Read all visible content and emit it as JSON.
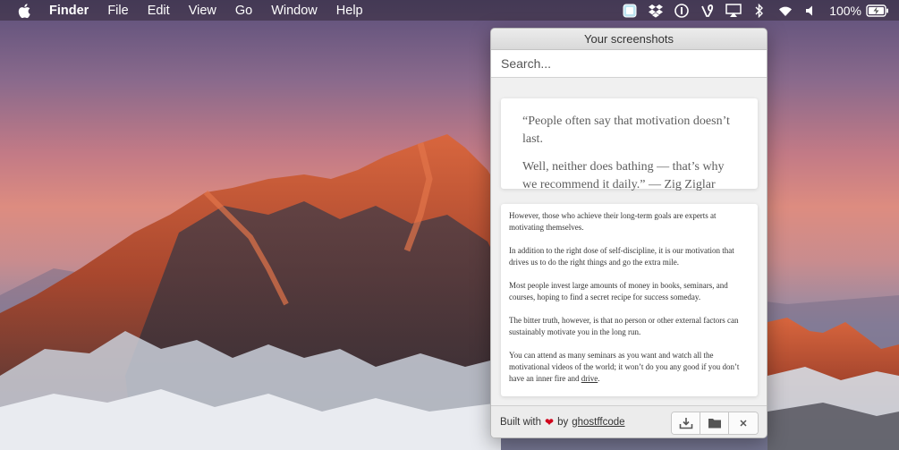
{
  "menubar": {
    "items": [
      {
        "label": "Finder",
        "bold": true
      },
      {
        "label": "File"
      },
      {
        "label": "Edit"
      },
      {
        "label": "View"
      },
      {
        "label": "Go"
      },
      {
        "label": "Window"
      },
      {
        "label": "Help"
      }
    ],
    "tray_icons": [
      "screenshot-app-icon",
      "dropbox-icon",
      "onepassword-icon",
      "vine-icon",
      "airplay-icon",
      "bluetooth-icon",
      "wifi-icon",
      "volume-icon"
    ],
    "battery_percent": "100%"
  },
  "popover": {
    "title": "Your screenshots",
    "search_placeholder": "Search...",
    "quote": {
      "line1": "“People often say that motivation doesn’t last.",
      "line2": "Well, neither does bathing — that’s why we recommend it daily.” — Zig Ziglar"
    },
    "text": {
      "p1": "However, those who achieve their long-term goals are experts at motivating themselves.",
      "p2": "In addition to the right dose of self-discipline, it is our motivation that drives us to do the right things and go the extra mile.",
      "p3": "Most people invest large amounts of money in books, seminars, and courses, hoping to find a secret recipe for success someday.",
      "p4": "The bitter truth, however, is that no person or other external factors can sustainably motivate you in the long run.",
      "p5_start": "You can attend as many seminars as you want and watch all the motivational videos of the world; it won’t do you any good if you don’t have an inner fire and ",
      "p5_link": "drive",
      "p5_end": "."
    },
    "footer": {
      "built_with": "Built with",
      "heart": "❤",
      "by": "by",
      "author": "ghostffcode"
    }
  },
  "colors": {
    "heart": "#d0021b",
    "menubar_text": "#ffffff"
  }
}
